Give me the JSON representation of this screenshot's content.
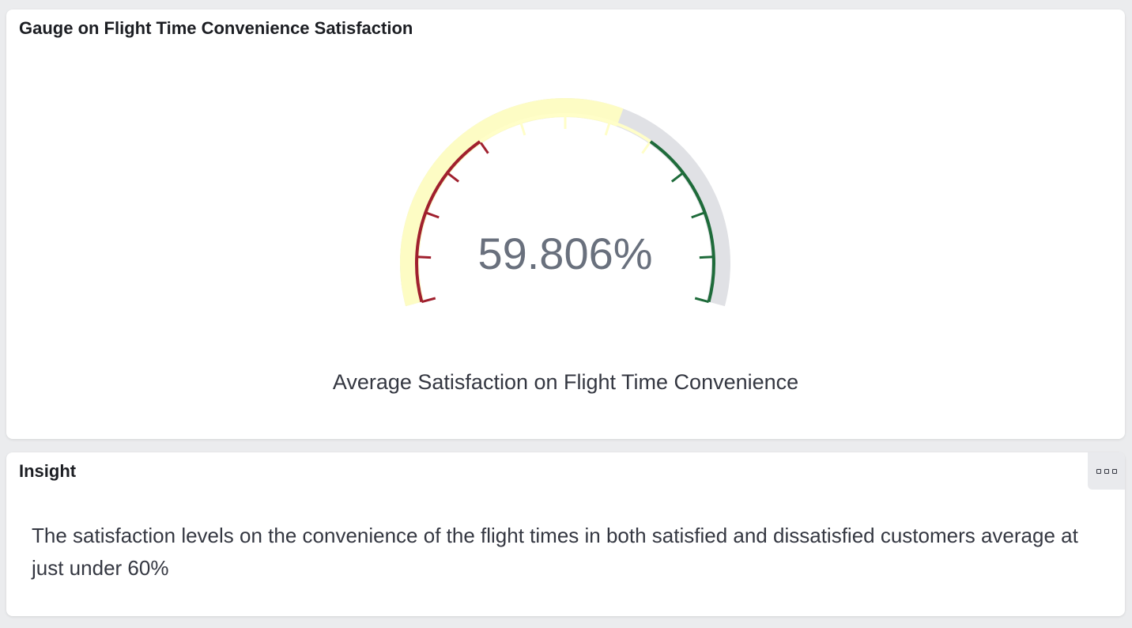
{
  "gauge_panel": {
    "title": "Gauge on Flight Time Convenience Satisfaction",
    "value_text": "59.806%",
    "label": "Average Satisfaction on Flight Time Convenience"
  },
  "chart_data": {
    "type": "gauge",
    "value": 59.806,
    "unit": "%",
    "range": [
      0,
      100
    ],
    "bands": [
      {
        "from": 0,
        "to": 33.33,
        "color": "#a0202e"
      },
      {
        "from": 33.33,
        "to": 66.67,
        "color": "#fffec8"
      },
      {
        "from": 66.67,
        "to": 100,
        "color": "#1e6b3a"
      }
    ],
    "fill_color": "#fdfcc4",
    "track_color": "#e0e1e5"
  },
  "insight_panel": {
    "title": "Insight",
    "menu_icon": "more-options-icon",
    "text": "The satisfaction levels on the convenience of the flight times in both satisfied and dissatisfied customers average at just under 60%"
  }
}
